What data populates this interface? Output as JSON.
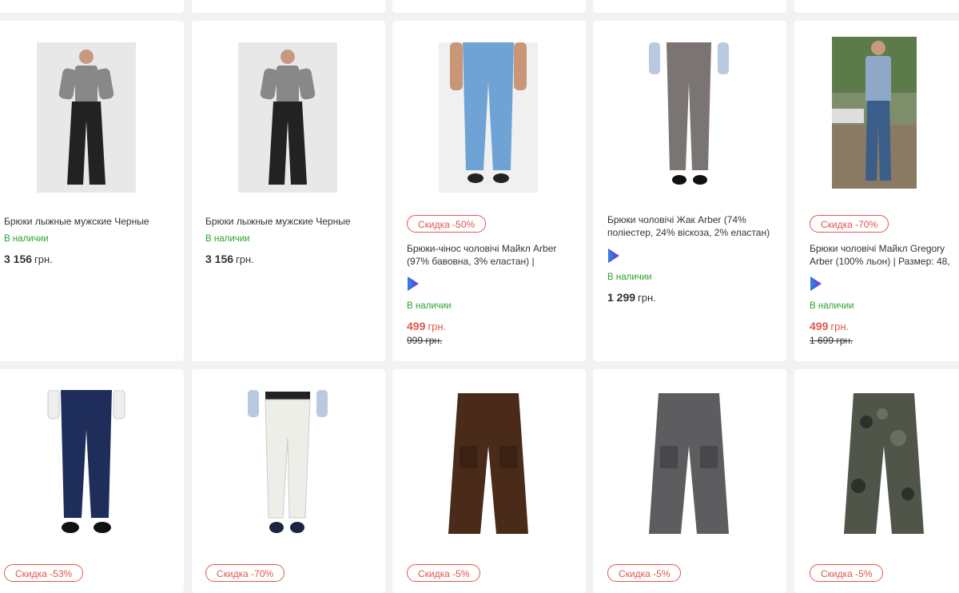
{
  "colors": {
    "accent": "#e2574c",
    "available": "#2ea22e",
    "logo": "#5a4fe0"
  },
  "row1": [
    {
      "title": "Брюки лыжные мужские Черные",
      "availability": "В наличии",
      "price": "3 156",
      "currency": "грн."
    },
    {
      "title": "Брюки лыжные мужские Черные",
      "availability": "В наличии",
      "price": "3 156",
      "currency": "грн."
    },
    {
      "badge": "Скидка -50%",
      "title": "Брюки-чінос чоловічі Майкл Arber (97% бавовна, 3% еластан) |",
      "availability": "В наличии",
      "price": "499",
      "currency": "грн.",
      "old_price": "999 грн."
    },
    {
      "title": "Брюки чоловічі Жак Arber (74% поліестер, 24% віскоза, 2% еластан)",
      "availability": "В наличии",
      "price": "1 299",
      "currency": "грн."
    },
    {
      "badge": "Скидка -70%",
      "title": "Брюки чоловічі Майкл Gregory Arber (100% льон) | Размер: 48,",
      "availability": "В наличии",
      "price": "499",
      "currency": "грн.",
      "old_price": "1 699 грн."
    }
  ],
  "row2": [
    {
      "badge": "Скидка -53%"
    },
    {
      "badge": "Скидка -70%"
    },
    {
      "badge": "Скидка -5%"
    },
    {
      "badge": "Скидка -5%"
    },
    {
      "badge": "Скидка -5%"
    }
  ]
}
